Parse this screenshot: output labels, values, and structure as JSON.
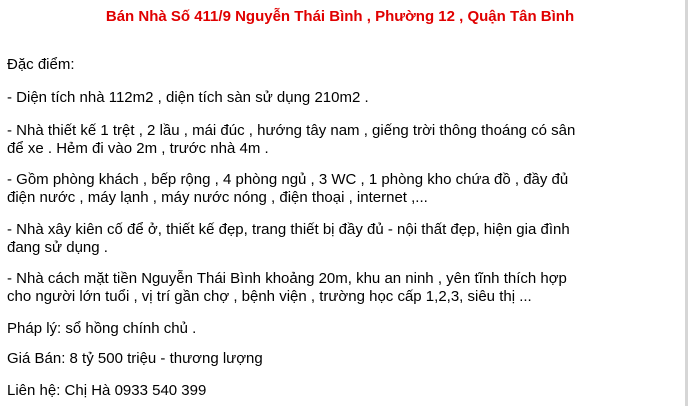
{
  "document": {
    "title": "Bán Nhà Số 411/9 Nguyễn Thái Bình , Phường 12 , Quận Tân Bình",
    "heading": "Đặc điểm:",
    "features": [
      {
        "lines": [
          "- Diện tích nhà 112m2 , diện tích sàn sử dụng  210m2 ."
        ]
      },
      {
        "lines": [
          "- Nhà thiết kế 1 trệt , 2 lầu , mái đúc , hướng tây nam , giếng trời thông thoáng có sân",
          "để xe . Hẻm đi vào 2m , trước nhà 4m ."
        ]
      },
      {
        "lines": [
          "- Gồm phòng khách , bếp rộng , 4 phòng ngủ , 3 WC , 1 phòng kho chứa đồ , đầy đủ",
          "điện nước , máy lạnh , máy nước nóng , điện thoại , internet ,..."
        ]
      },
      {
        "lines": [
          "- Nhà xây kiên cố để ở, thiết kế đẹp, trang thiết bị đầy đủ - nội thất đẹp, hiện gia đình",
          "đang sử dụng ."
        ]
      },
      {
        "lines": [
          "- Nhà cách mặt tiền Nguyễn Thái Bình khoảng 20m, khu an ninh , yên tĩnh thích hợp",
          "cho người lớn tuổi , vị trí  gần chợ , bệnh viện , trường học cấp 1,2,3, siêu thị ..."
        ]
      }
    ],
    "legal": "Pháp lý: sổ hồng chính chủ .",
    "price": "Giá Bán: 8 tỷ 500 triệu - thương lượng",
    "contact": "Liên hệ: Chị Hà 0933 540 399"
  },
  "colors": {
    "title": "#e00000",
    "text": "#000000",
    "background": "#ffffff",
    "right_edge": "#d6d6d6"
  }
}
